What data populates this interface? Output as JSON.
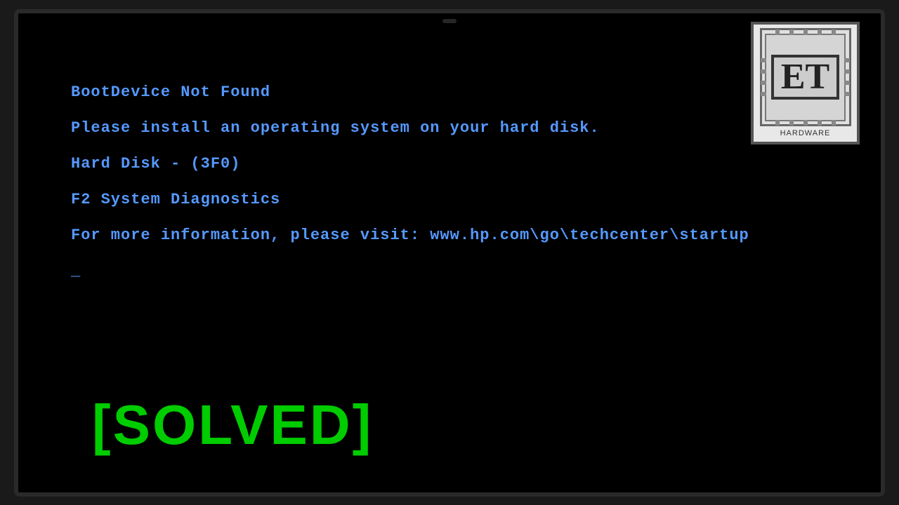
{
  "screen": {
    "background": "#000000"
  },
  "bios": {
    "line1": "BootDevice Not Found",
    "line2": "Please install an operating system on your hard disk.",
    "line3": "Hard Disk - (3F0)",
    "line4": "F2 System Diagnostics",
    "line5": "For more information, please visit: www.hp.com\\go\\techcenter\\startup",
    "cursor": "_",
    "text_color": "#5599ff"
  },
  "overlay": {
    "solved_text": "[SOLVED]",
    "solved_color": "#00cc00"
  },
  "watermark": {
    "logo_text": "ET",
    "label": "HARDWARE"
  }
}
